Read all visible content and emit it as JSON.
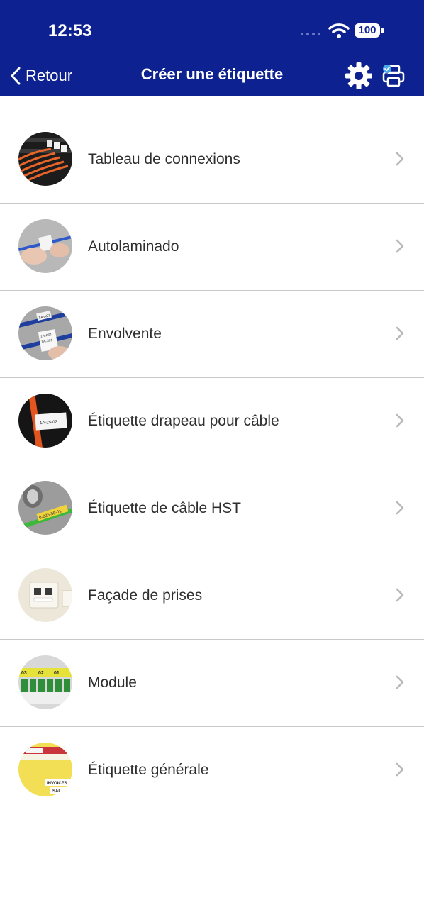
{
  "status_bar": {
    "time": "12:53",
    "battery": "100"
  },
  "nav": {
    "back_label": "Retour",
    "title": "Créer une étiquette"
  },
  "items": [
    {
      "label": "Tableau de connexions"
    },
    {
      "label": "Autolaminado"
    },
    {
      "label": "Envolvente"
    },
    {
      "label": "Étiquette drapeau pour câble"
    },
    {
      "label": "Étiquette de câble HST"
    },
    {
      "label": "Façade de prises"
    },
    {
      "label": "Module"
    },
    {
      "label": "Étiquette générale"
    }
  ],
  "thumb_texts": {
    "wrap": [
      "1A-A01",
      "1A-A01",
      "1A-301"
    ],
    "flag": "1A-25-02",
    "hst": "0-025-58-01",
    "module": [
      "03",
      "02",
      "01"
    ],
    "general": [
      "INVOICES",
      "SAL"
    ]
  },
  "colors": {
    "header": "#0d2290",
    "divider": "#c8c8c8",
    "chevron": "#b8b8b8"
  }
}
